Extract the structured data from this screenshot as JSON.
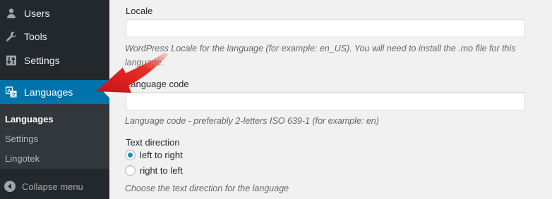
{
  "sidebar": {
    "items": [
      {
        "label": "Users",
        "icon": "users-icon"
      },
      {
        "label": "Tools",
        "icon": "wrench-icon"
      },
      {
        "label": "Settings",
        "icon": "settings-icon"
      },
      {
        "label": "Languages",
        "icon": "translate-icon",
        "active": true
      }
    ],
    "submenu": [
      {
        "label": "Languages",
        "current": true
      },
      {
        "label": "Settings"
      },
      {
        "label": "Lingotek"
      }
    ],
    "collapse_label": "Collapse menu"
  },
  "form": {
    "locale": {
      "label": "Locale",
      "value": "",
      "description": "WordPress Locale for the language (for example: en_US). You will need to install the .mo file for this language."
    },
    "language_code": {
      "label": "Language code",
      "value": "",
      "description": "Language code - preferably 2-letters ISO 639-1 (for example: en)"
    },
    "text_direction": {
      "label": "Text direction",
      "options": [
        {
          "label": "left to right",
          "checked": true
        },
        {
          "label": "right to left",
          "checked": false
        }
      ],
      "description": "Choose the text direction for the language"
    }
  },
  "colors": {
    "sidebar_bg": "#23282d",
    "submenu_bg": "#32373c",
    "active_bg": "#0073aa",
    "annotation_arrow": "#e0201f"
  }
}
